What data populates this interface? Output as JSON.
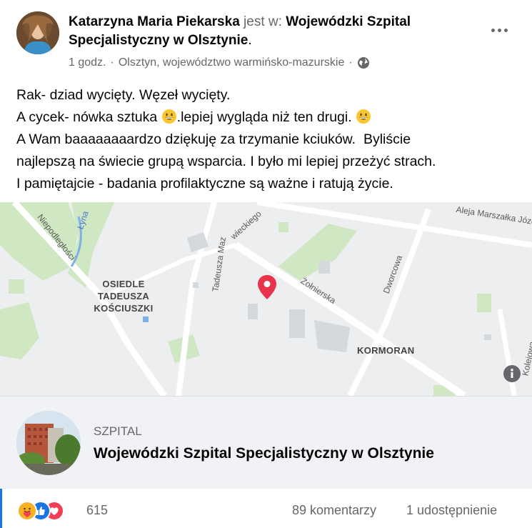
{
  "post": {
    "author_name": "Katarzyna Maria Piekarska",
    "is_at": "jest w:",
    "place_name": "Wojewódzki Szpital Specjalistyczny w Olsztynie",
    "place_suffix": ".",
    "time": "1 godz.",
    "separator": "·",
    "location": "Olsztyn, województwo warmińsko-mazurskie",
    "separator2": "·",
    "privacy_icon": "globe-icon",
    "more_icon": "more-options-icon",
    "text_lines": [
      "Rak- dziad wycięty. Węzeł wycięty.",
      "A cycek- nówka sztuka ",
      ".lepiej wygląda niż ten drugi. ",
      "A Wam baaaaaaaardzo dziękuję za trzymanie kciuków.  Byliście",
      "najlepszą na świecie grupą wsparcia. I było mi lepiej przeżyć strach.",
      "I pamiętajcie - badania profilaktyczne są ważne i ratują życie."
    ]
  },
  "map": {
    "labels": {
      "osiedle": "OSIEDLE",
      "tadeusza": "TADEUSZA",
      "kosciuszki": "KOŚCIUSZKI",
      "kormoran": "KORMORAN"
    },
    "streets": {
      "niepodleglosci": "Niepodległości",
      "lyna": "Łyna",
      "tadeusza_maz": "Tadeusza Maz",
      "wieckiego": "wieckiego",
      "zolnierska": "Żołnierska",
      "dworcowa": "Dworcowa",
      "aleja": "Aleja Marszałka Józef",
      "kolejowa": "Kolejowa"
    },
    "info_icon": "info-icon",
    "pin_icon": "map-pin-icon",
    "pin_color": "#e8334a"
  },
  "card": {
    "category": "SZPITAL",
    "title": "Wojewódzki Szpital Specjalistyczny w Olsztynie"
  },
  "footer": {
    "reaction_count": "615",
    "comments": "89 komentarzy",
    "shares": "1 udostępnienie",
    "reaction_icons": [
      "care-reaction-icon",
      "like-reaction-icon",
      "love-reaction-icon"
    ],
    "accent": "#1b74e4"
  }
}
